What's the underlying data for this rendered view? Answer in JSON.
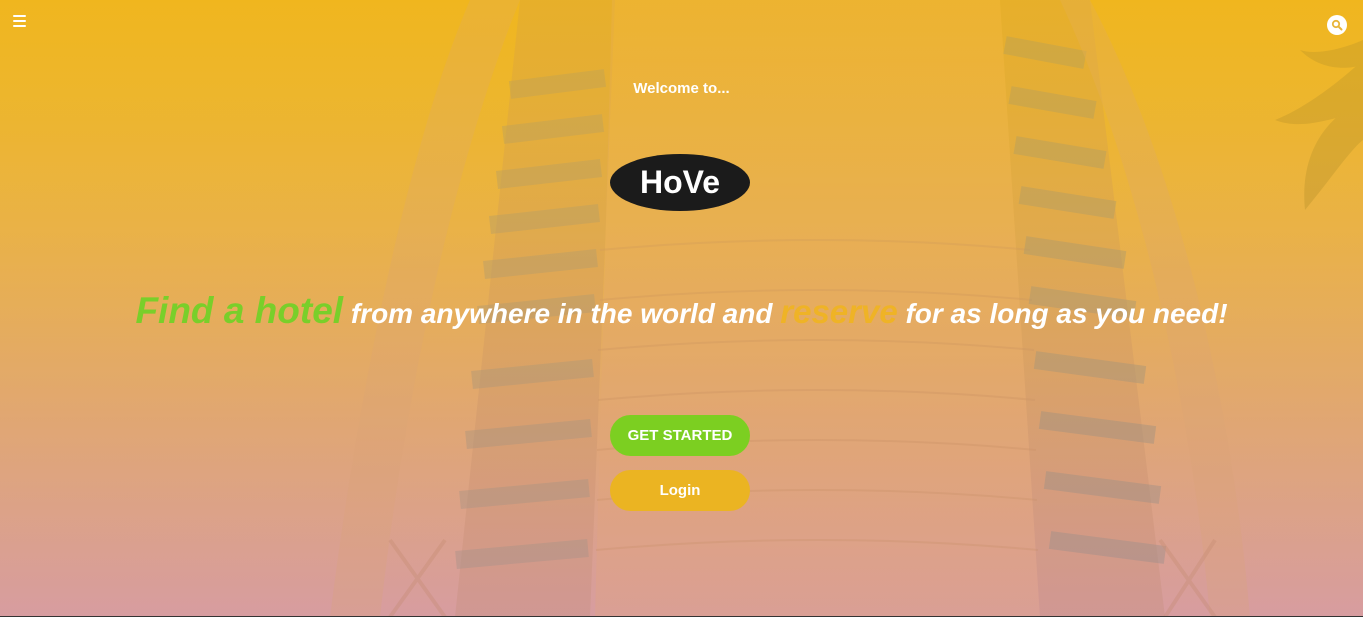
{
  "header": {
    "menu_icon": "hamburger-menu-icon",
    "search_icon": "search-icon"
  },
  "hero": {
    "welcome": "Welcome to...",
    "logo_text": "HoVe",
    "tagline": {
      "part1": "Find a hotel",
      "part2": "from anywhere in the world and",
      "part3": "reserve",
      "part4": "for as long as you need!"
    }
  },
  "buttons": {
    "get_started": "GET STARTED",
    "login": "Login"
  },
  "colors": {
    "accent_green": "#7ccf21",
    "accent_gold": "#ebb422",
    "logo_bg": "#1b1b1b"
  }
}
